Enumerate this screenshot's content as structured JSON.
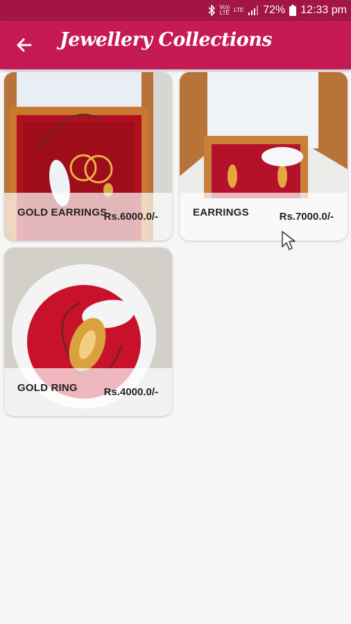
{
  "status_bar": {
    "network_top": "Vo))",
    "network_bottom": "LTE",
    "lte_label": "LTE",
    "battery": "72%",
    "time": "12:33 pm"
  },
  "app_bar": {
    "title": "Jewellery Collections",
    "back_icon": "arrow-left-icon"
  },
  "colors": {
    "status_bar": "#a31546",
    "app_bar": "#c51a55",
    "background": "#f6f6f6"
  },
  "products": [
    {
      "name": "GOLD EARRINGS",
      "price": "Rs.6000.0/-"
    },
    {
      "name": "EARRINGS",
      "price": "Rs.7000.0/-"
    },
    {
      "name": "GOLD RING",
      "price": "Rs.4000.0/-"
    }
  ]
}
